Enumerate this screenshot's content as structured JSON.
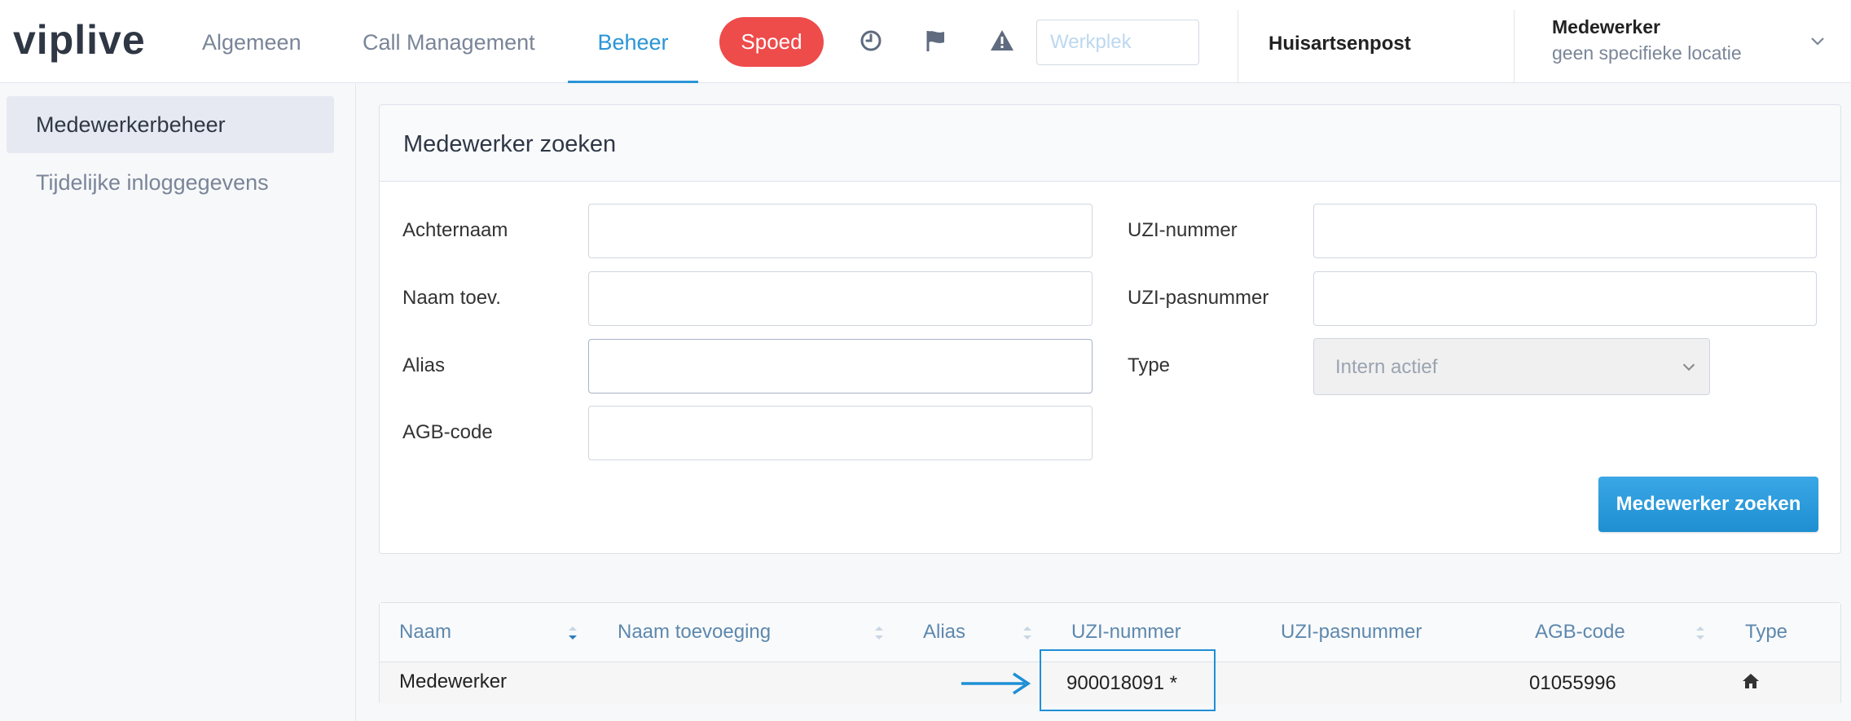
{
  "app": {
    "logo": "viplive"
  },
  "nav": {
    "tabs": [
      {
        "label": "Algemeen"
      },
      {
        "label": "Call Management"
      },
      {
        "label": "Beheer"
      }
    ],
    "spoed_label": "Spoed",
    "werkplek_placeholder": "Werkplek",
    "location": "Huisartsenpost",
    "user_name": "Medewerker",
    "user_location": "geen specifieke locatie",
    "icons": [
      "clock-icon",
      "flag-icon",
      "warning-icon",
      "chevron-down-icon"
    ]
  },
  "sidebar": {
    "items": [
      {
        "label": "Medewerkerbeheer",
        "active": true
      },
      {
        "label": "Tijdelijke inloggegevens",
        "active": false
      }
    ]
  },
  "search": {
    "title": "Medewerker zoeken",
    "fields": {
      "achternaam": {
        "label": "Achternaam",
        "value": ""
      },
      "naam_toev": {
        "label": "Naam toev.",
        "value": ""
      },
      "alias": {
        "label": "Alias",
        "value": ""
      },
      "agb_code": {
        "label": "AGB-code",
        "value": ""
      },
      "uzi_nummer": {
        "label": "UZI-nummer",
        "value": ""
      },
      "uzi_pasnummer": {
        "label": "UZI-pasnummer",
        "value": ""
      },
      "type": {
        "label": "Type",
        "value": "Intern actief"
      }
    },
    "submit_label": "Medewerker zoeken"
  },
  "results": {
    "columns": [
      "Naam",
      "Naam toevoeging",
      "Alias",
      "UZI-nummer",
      "UZI-pasnummer",
      "AGB-code",
      "Type"
    ],
    "rows": [
      {
        "naam": "Medewerker",
        "naam_toevoeging": "",
        "alias": "",
        "uzi_nummer": "900018091 *",
        "uzi_pasnummer": "",
        "agb_code": "01055996",
        "type_icon": "home-icon"
      }
    ]
  },
  "colors": {
    "accent": "#2a95d6",
    "spoed": "#ee4b4b",
    "highlight": "#1e8fd5"
  }
}
